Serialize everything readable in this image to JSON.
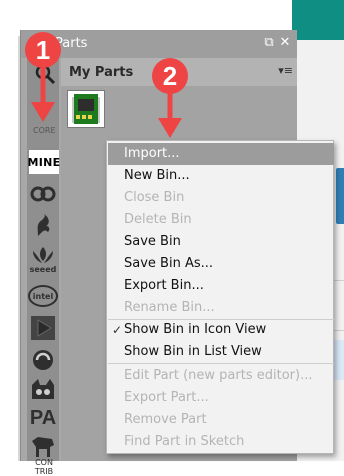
{
  "dock": {
    "title": "Parts",
    "float_label": "⧉",
    "close_label": "✕"
  },
  "bins": {
    "mine_label": "MINE",
    "core_label": "CORE",
    "contrib_label": "CON TRIB",
    "seeed_label": "seeed",
    "intel_label": "intel",
    "pa_label": "PA"
  },
  "current_bin": {
    "name": "My Parts",
    "menu_label": "▾≡"
  },
  "callouts": {
    "one": "1",
    "two": "2"
  },
  "context_menu": {
    "items": [
      {
        "label": "Import...",
        "state": "highlighted"
      },
      {
        "label": "New Bin...",
        "state": "enabled"
      },
      {
        "label": "Close Bin",
        "state": "disabled"
      },
      {
        "label": "Delete Bin",
        "state": "disabled"
      },
      {
        "label": "Save Bin",
        "state": "enabled"
      },
      {
        "label": "Save Bin As...",
        "state": "enabled"
      },
      {
        "label": "Export Bin...",
        "state": "enabled"
      },
      {
        "label": "Rename Bin...",
        "state": "disabled"
      },
      {
        "label": "Show Bin in Icon View",
        "state": "checked"
      },
      {
        "label": "Show Bin in List View",
        "state": "enabled"
      },
      {
        "label": "Edit Part (new parts editor)...",
        "state": "disabled"
      },
      {
        "label": "Export Part...",
        "state": "disabled"
      },
      {
        "label": "Remove Part",
        "state": "disabled"
      },
      {
        "label": "Find Part in Sketch",
        "state": "disabled"
      }
    ],
    "check_glyph": "✓"
  },
  "colors": {
    "callout": "#ee4444",
    "highlight": "#9c9c9c",
    "teal": "#0f8f83"
  }
}
